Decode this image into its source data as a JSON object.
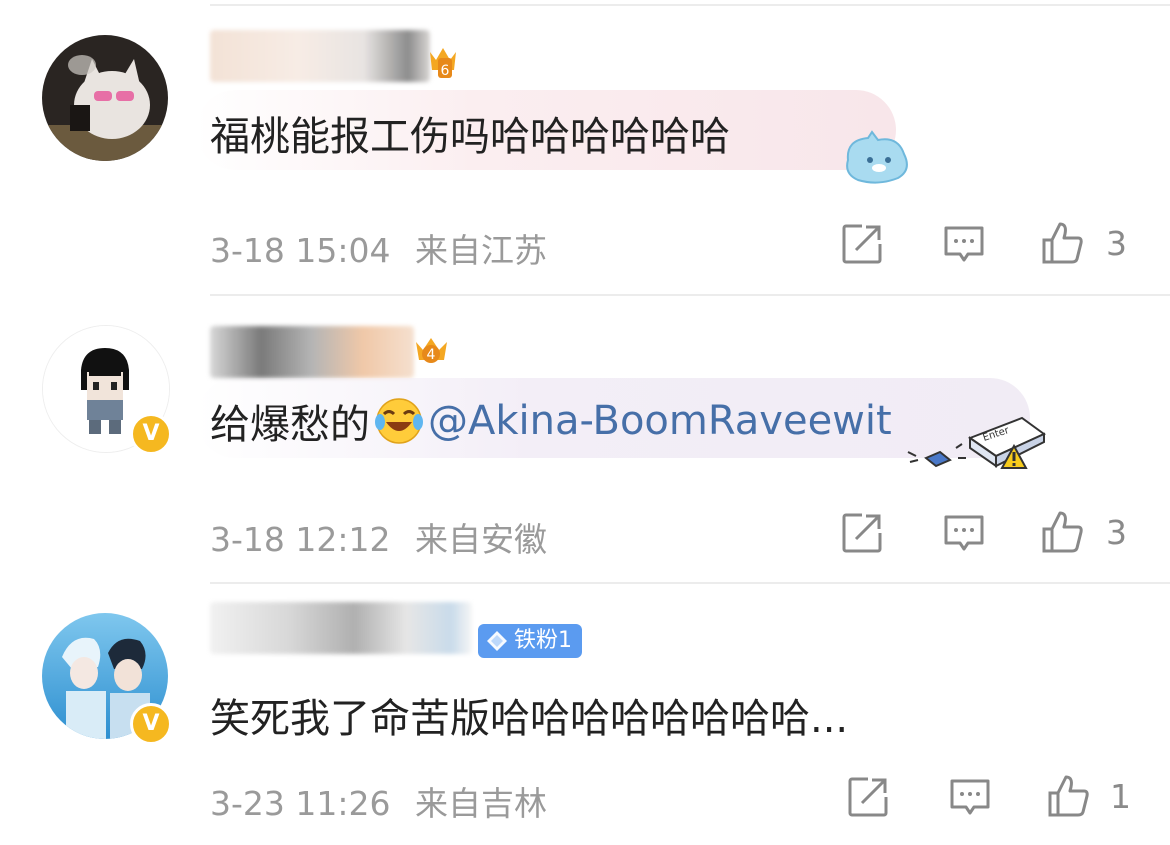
{
  "comments": [
    {
      "text": "福桃能报工伤吗哈哈哈哈哈哈",
      "date": "3-18 15:04",
      "location": "来自江苏",
      "likes": "3",
      "level_badge": "6"
    },
    {
      "text": "给爆愁的",
      "mention": "@Akina-BoomRaveewit",
      "date": "3-18 12:12",
      "location": "来自安徽",
      "likes": "3",
      "level_badge": "4",
      "verified": "V",
      "sticker_text": "Enter"
    },
    {
      "text": "笑死我了命苦版哈哈哈哈哈哈哈哈...",
      "date": "3-23 11:26",
      "location": "来自吉林",
      "likes": "1",
      "fan_badge": "铁粉1",
      "verified": "V"
    }
  ],
  "icons": {
    "share": "share-icon",
    "comment": "comment-icon",
    "like": "thumbs-up-icon"
  },
  "colors": {
    "mention": "#466fa8",
    "verified": "#f5b820",
    "fan_badge": "#5b9bf0"
  }
}
